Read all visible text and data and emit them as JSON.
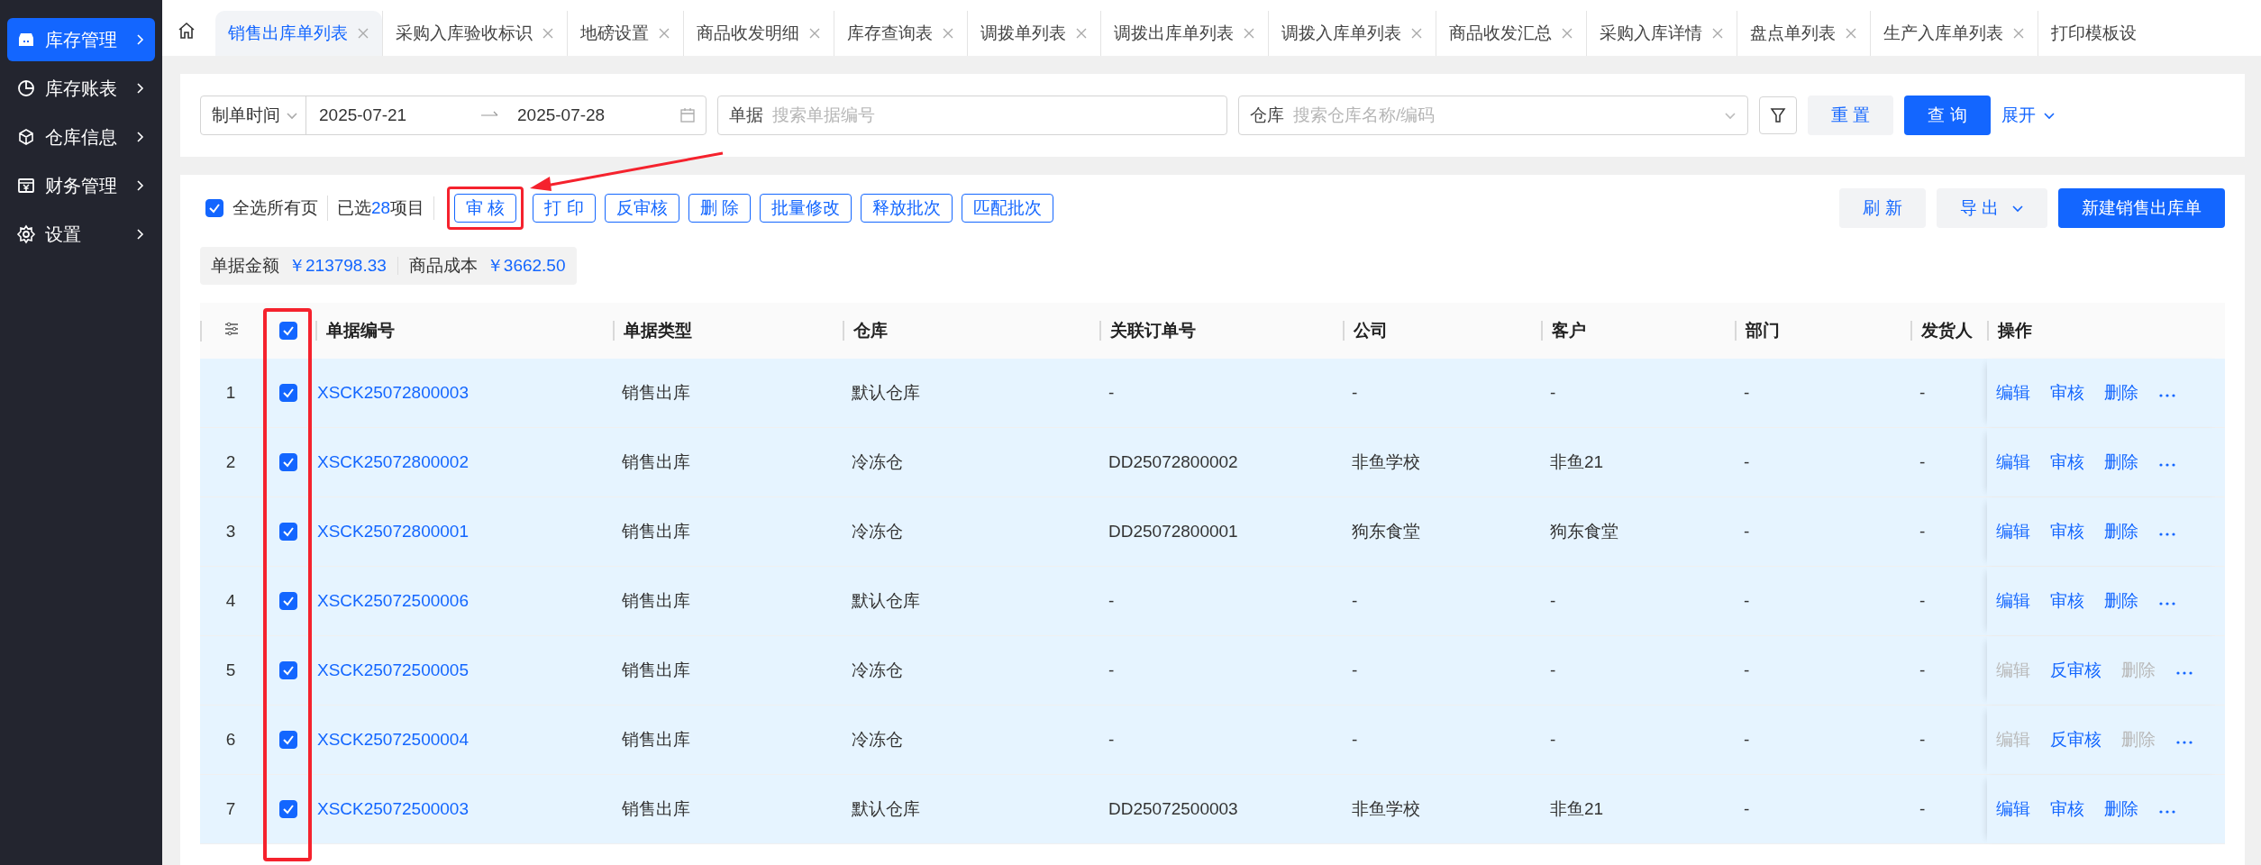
{
  "sidebar": {
    "items": [
      {
        "label": "库存管理",
        "selected": true
      },
      {
        "label": "库存账表",
        "selected": false
      },
      {
        "label": "仓库信息",
        "selected": false
      },
      {
        "label": "财务管理",
        "selected": false
      },
      {
        "label": "设置",
        "selected": false
      }
    ]
  },
  "tabs": [
    {
      "label": "销售出库单列表",
      "selected": true,
      "closable": true
    },
    {
      "label": "采购入库验收标识",
      "selected": false,
      "closable": true
    },
    {
      "label": "地磅设置",
      "selected": false,
      "closable": true
    },
    {
      "label": "商品收发明细",
      "selected": false,
      "closable": true
    },
    {
      "label": "库存查询表",
      "selected": false,
      "closable": true
    },
    {
      "label": "调拨单列表",
      "selected": false,
      "closable": true
    },
    {
      "label": "调拨出库单列表",
      "selected": false,
      "closable": true
    },
    {
      "label": "调拨入库单列表",
      "selected": false,
      "closable": true
    },
    {
      "label": "商品收发汇总",
      "selected": false,
      "closable": true
    },
    {
      "label": "采购入库详情",
      "selected": false,
      "closable": true
    },
    {
      "label": "盘点单列表",
      "selected": false,
      "closable": true
    },
    {
      "label": "生产入库单列表",
      "selected": false,
      "closable": true
    },
    {
      "label": "打印模板设",
      "selected": false,
      "closable": false
    }
  ],
  "filters": {
    "date_type": "制单时间",
    "start_date": "2025-07-21",
    "end_date": "2025-07-28",
    "document_label": "单据",
    "document_placeholder": "搜索单据编号",
    "warehouse_label": "仓库",
    "warehouse_placeholder": "搜索仓库名称/编码",
    "reset": "重 置",
    "search": "查 询",
    "expand": "展开"
  },
  "toolbar": {
    "select_all": {
      "label": "全选所有页",
      "checked": true
    },
    "selected_prefix": "已选",
    "selected_count": "28",
    "selected_suffix": "项目",
    "actions": [
      {
        "label": "审 核",
        "highlighted": true
      },
      {
        "label": "打 印",
        "highlighted": false
      },
      {
        "label": "反审核",
        "highlighted": false
      },
      {
        "label": "删 除",
        "highlighted": false
      },
      {
        "label": "批量修改",
        "highlighted": false
      },
      {
        "label": "释放批次",
        "highlighted": false
      },
      {
        "label": "匹配批次",
        "highlighted": false
      }
    ],
    "buttons": [
      {
        "label": "刷 新",
        "kind": "default"
      },
      {
        "label": "导 出",
        "kind": "dropdown"
      },
      {
        "label": "新建销售出库单",
        "kind": "primary"
      }
    ]
  },
  "summary": [
    {
      "label": "单据金额",
      "value": "￥213798.33"
    },
    {
      "label": "商品成本",
      "value": "￥3662.50"
    }
  ],
  "table": {
    "header_checked": true,
    "checkbox_column_highlighted": true,
    "columns": [
      "单据编号",
      "单据类型",
      "仓库",
      "关联订单号",
      "公司",
      "客户",
      "部门",
      "发货人",
      "操作"
    ],
    "rows": [
      {
        "index": "1",
        "checked": true,
        "cells": [
          "XSCK25072800003",
          "销售出库",
          "默认仓库",
          "-",
          "-",
          "-",
          "-",
          "-"
        ],
        "actions": [
          {
            "label": "编辑",
            "disabled": false
          },
          {
            "label": "审核",
            "disabled": false
          },
          {
            "label": "删除",
            "disabled": false
          }
        ]
      },
      {
        "index": "2",
        "checked": true,
        "cells": [
          "XSCK25072800002",
          "销售出库",
          "冷冻仓",
          "DD25072800002",
          "非鱼学校",
          "非鱼21",
          "-",
          "-"
        ],
        "actions": [
          {
            "label": "编辑",
            "disabled": false
          },
          {
            "label": "审核",
            "disabled": false
          },
          {
            "label": "删除",
            "disabled": false
          }
        ]
      },
      {
        "index": "3",
        "checked": true,
        "cells": [
          "XSCK25072800001",
          "销售出库",
          "冷冻仓",
          "DD25072800001",
          "狗东食堂",
          "狗东食堂",
          "-",
          "-"
        ],
        "actions": [
          {
            "label": "编辑",
            "disabled": false
          },
          {
            "label": "审核",
            "disabled": false
          },
          {
            "label": "删除",
            "disabled": false
          }
        ]
      },
      {
        "index": "4",
        "checked": true,
        "cells": [
          "XSCK25072500006",
          "销售出库",
          "默认仓库",
          "-",
          "-",
          "-",
          "-",
          "-"
        ],
        "actions": [
          {
            "label": "编辑",
            "disabled": false
          },
          {
            "label": "审核",
            "disabled": false
          },
          {
            "label": "删除",
            "disabled": false
          }
        ]
      },
      {
        "index": "5",
        "checked": true,
        "cells": [
          "XSCK25072500005",
          "销售出库",
          "冷冻仓",
          "-",
          "-",
          "-",
          "-",
          "-"
        ],
        "actions": [
          {
            "label": "编辑",
            "disabled": true
          },
          {
            "label": "反审核",
            "disabled": false
          },
          {
            "label": "删除",
            "disabled": true
          }
        ]
      },
      {
        "index": "6",
        "checked": true,
        "cells": [
          "XSCK25072500004",
          "销售出库",
          "冷冻仓",
          "-",
          "-",
          "-",
          "-",
          "-"
        ],
        "actions": [
          {
            "label": "编辑",
            "disabled": true
          },
          {
            "label": "反审核",
            "disabled": false
          },
          {
            "label": "删除",
            "disabled": true
          }
        ]
      },
      {
        "index": "7",
        "checked": true,
        "cells": [
          "XSCK25072500003",
          "销售出库",
          "默认仓库",
          "DD25072500003",
          "非鱼学校",
          "非鱼21",
          "-",
          "-"
        ],
        "actions": [
          {
            "label": "编辑",
            "disabled": false
          },
          {
            "label": "审核",
            "disabled": false
          },
          {
            "label": "删除",
            "disabled": false
          }
        ]
      }
    ]
  }
}
